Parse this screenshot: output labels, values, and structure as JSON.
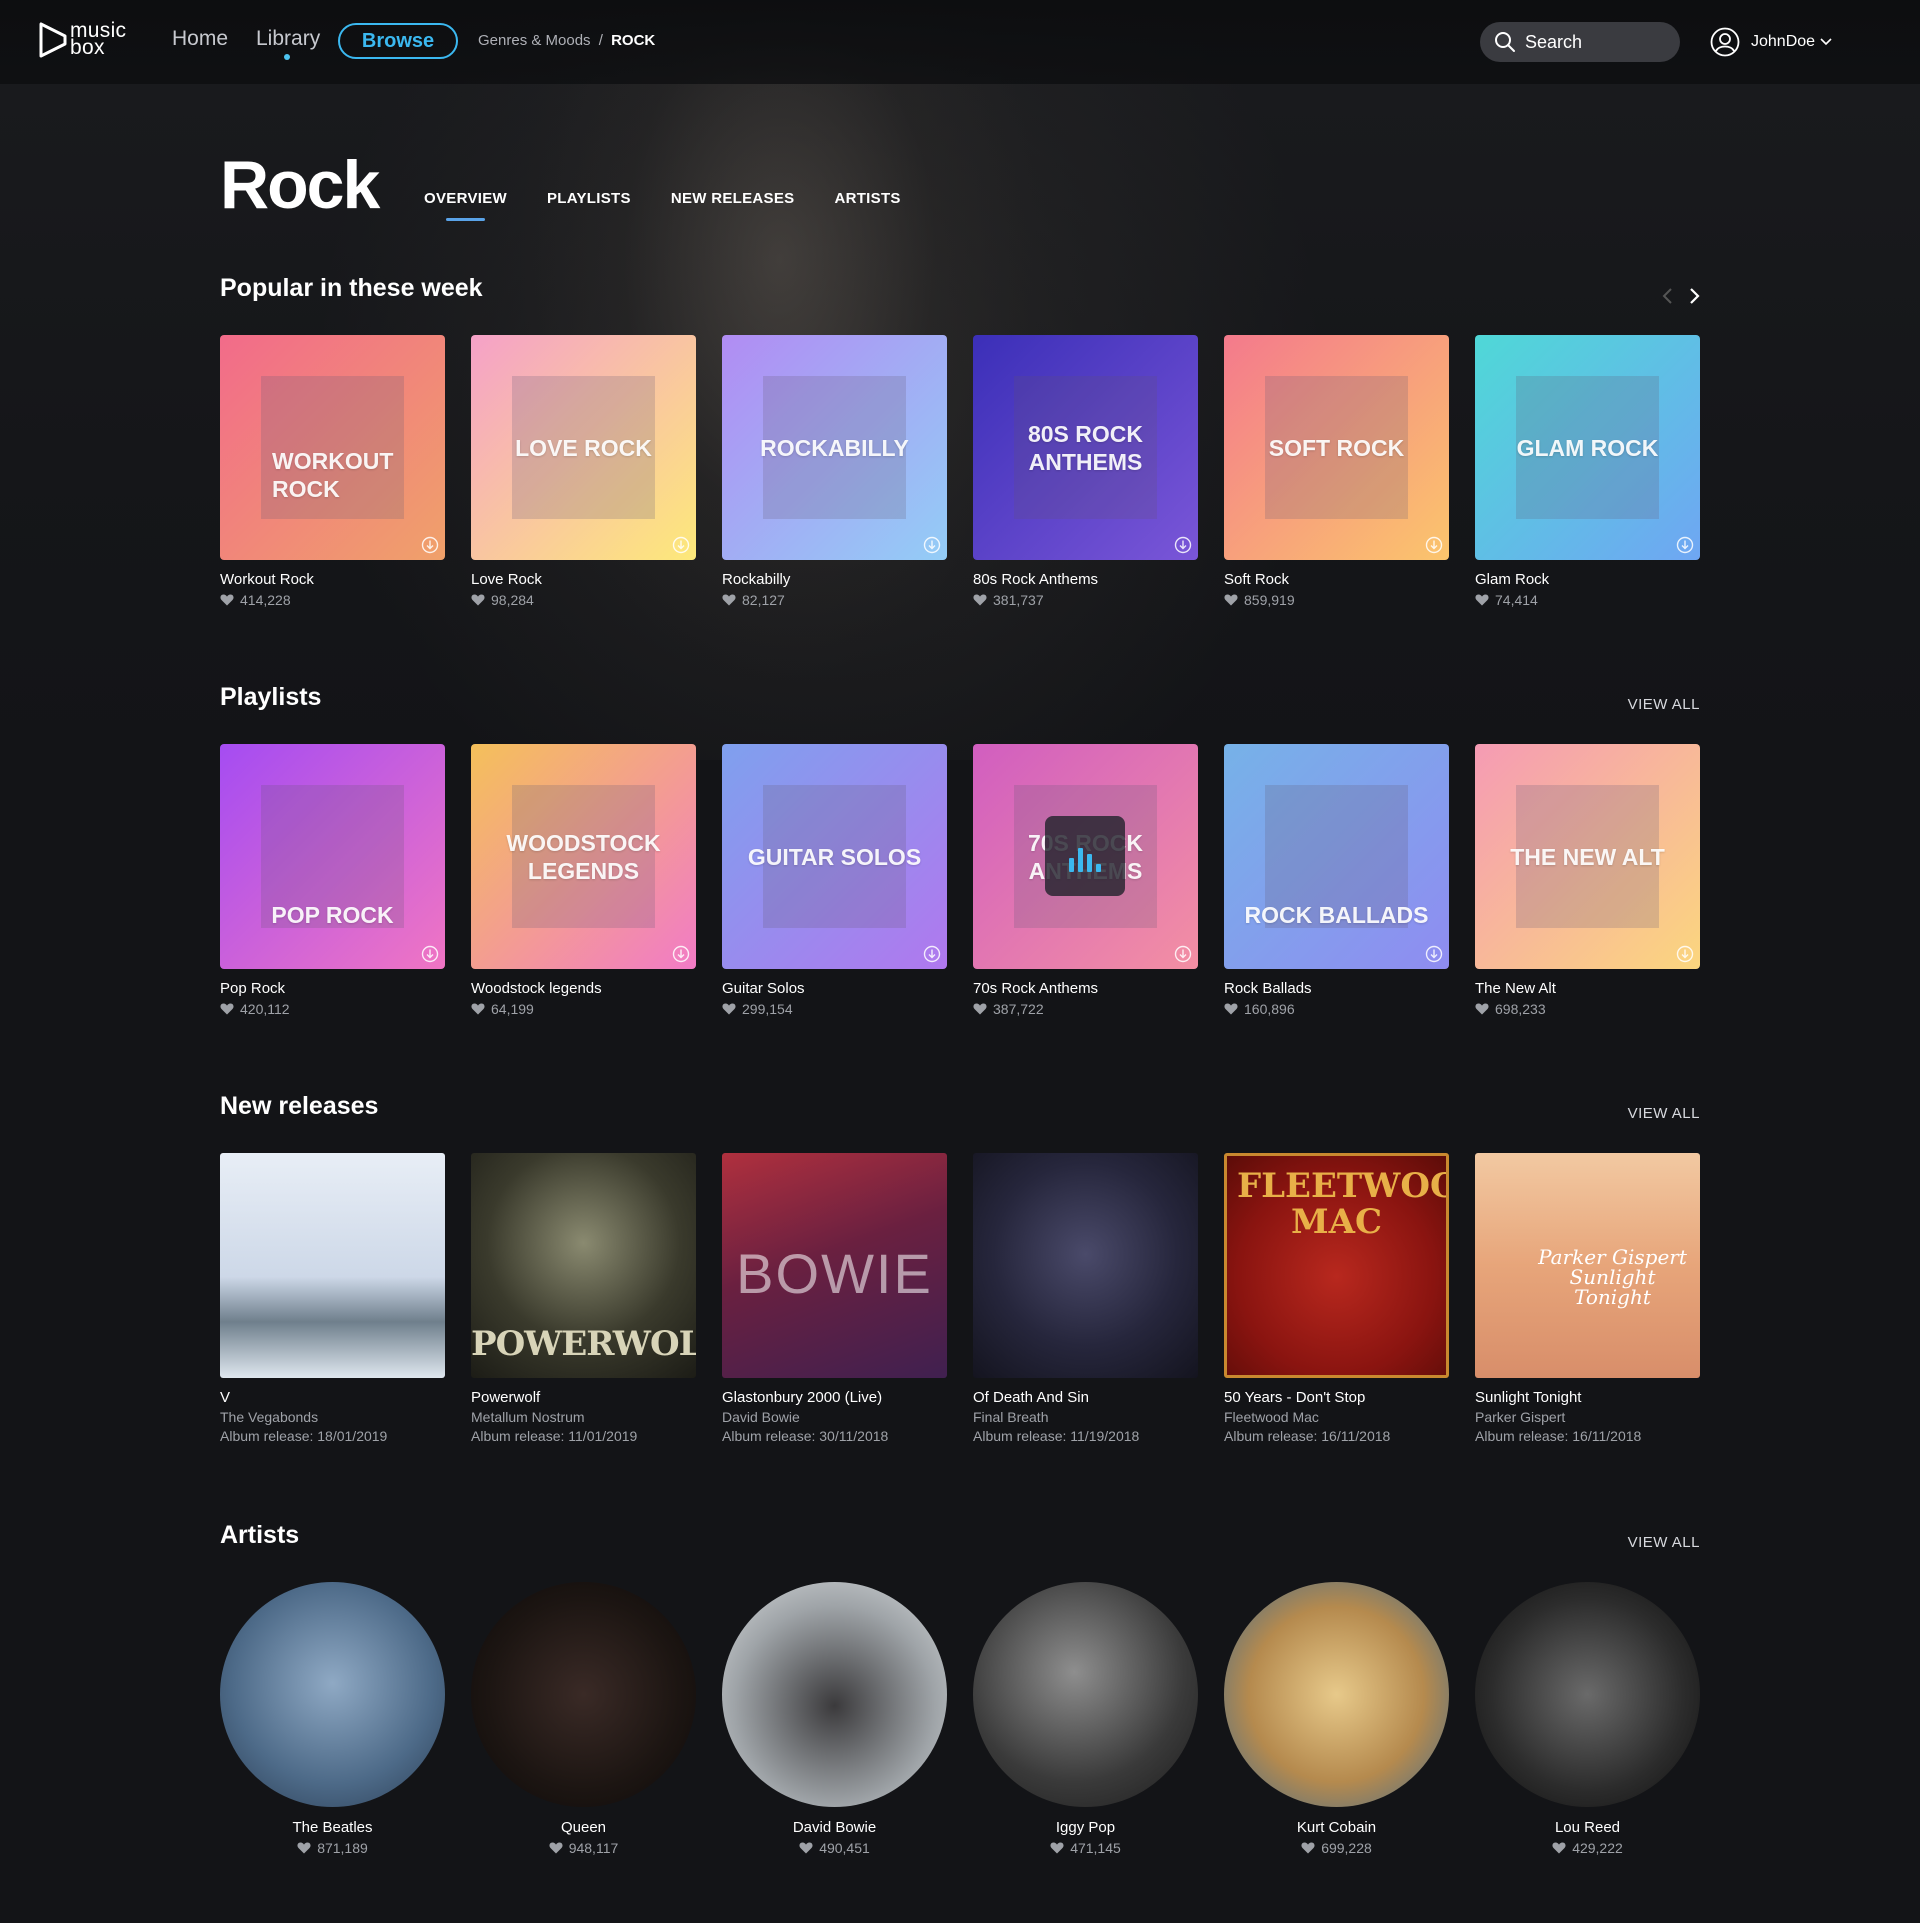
{
  "app": {
    "logo_text_line1": "music",
    "logo_text_line2": "box"
  },
  "nav": {
    "home": "Home",
    "library": "Library",
    "browse": "Browse",
    "breadcrumb": {
      "parent": "Genres & Moods",
      "sep": "/",
      "current": "ROCK"
    }
  },
  "search": {
    "label": "Search"
  },
  "user": {
    "name": "JohnDoe"
  },
  "page": {
    "title": "Rock",
    "tabs": [
      "OVERVIEW",
      "PLAYLISTS",
      "NEW RELEASES",
      "ARTISTS"
    ],
    "active_tab": "OVERVIEW"
  },
  "sections": {
    "popular": {
      "title": "Popular in these week",
      "items": [
        {
          "cover_text": "WORKOUT ROCK",
          "title": "Workout Rock",
          "likes": "414,228",
          "gradient": [
            "#f26b8a",
            "#f0a16a"
          ]
        },
        {
          "cover_text": "LOVE ROCK",
          "title": "Love Rock",
          "likes": "98,284",
          "gradient": [
            "#f5a1c8",
            "#fde97a"
          ]
        },
        {
          "cover_text": "ROCKABILLY",
          "title": "Rockabilly",
          "likes": "82,127",
          "gradient": [
            "#b18cf3",
            "#93cdf6"
          ]
        },
        {
          "cover_text": "80s ROCK ANTHEMS",
          "title": "80s Rock Anthems",
          "likes": "381,737",
          "gradient": [
            "#3b2fb8",
            "#7a56d8"
          ]
        },
        {
          "cover_text": "SOFT ROCK",
          "title": "Soft Rock",
          "likes": "859,919",
          "gradient": [
            "#f47a8c",
            "#fbc56c"
          ]
        },
        {
          "cover_text": "GLAM ROCK",
          "title": "Glam Rock",
          "likes": "74,414",
          "gradient": [
            "#4fd8d7",
            "#6fa6f3"
          ]
        }
      ]
    },
    "playlists": {
      "title": "Playlists",
      "view_all": "VIEW ALL",
      "items": [
        {
          "cover_text": "POP ROCK",
          "title": "Pop Rock",
          "likes": "420,112",
          "gradient": [
            "#a54cf2",
            "#f075c3"
          ]
        },
        {
          "cover_text": "WOODSTOCK LEGENDS",
          "title": "Woodstock legends",
          "likes": "64,199",
          "gradient": [
            "#f4c05a",
            "#f27bc6"
          ]
        },
        {
          "cover_text": "GUITAR SOLOS",
          "title": "Guitar Solos",
          "likes": "299,154",
          "gradient": [
            "#7fa0ee",
            "#b078ee"
          ]
        },
        {
          "cover_text": "70s ROCK ANTHEMS",
          "title": "70s Rock Anthems",
          "likes": "387,722",
          "gradient": [
            "#d15ec0",
            "#f38fa3"
          ]
        },
        {
          "cover_text": "ROCK BALLADS",
          "title": "Rock Ballads",
          "likes": "160,896",
          "gradient": [
            "#76b2e8",
            "#8f8cf1"
          ]
        },
        {
          "cover_text": "THE NEW ALT",
          "title": "The New Alt",
          "likes": "698,233",
          "gradient": [
            "#f59bb4",
            "#fbd67e"
          ]
        }
      ]
    },
    "new_releases": {
      "title": "New releases",
      "view_all": "VIEW ALL",
      "items": [
        {
          "title": "V",
          "artist": "The Vegabonds",
          "date": "Album release: 18/01/2019",
          "cover_text": ""
        },
        {
          "title": "Powerwolf",
          "artist": "Metallum Nostrum",
          "date": "Album release: 11/01/2019",
          "cover_text": "POWERWOLF"
        },
        {
          "title": "Glastonbury 2000 (Live)",
          "artist": "David Bowie",
          "date": "Album release: 30/11/2018",
          "cover_text": "BOWIE"
        },
        {
          "title": "Of Death And Sin",
          "artist": "Final Breath",
          "date": "Album release: 11/19/2018",
          "cover_text": ""
        },
        {
          "title": "50 Years - Don't Stop",
          "artist": "Fleetwood Mac",
          "date": "Album release: 16/11/2018",
          "cover_text": "FLEETWOOD MAC"
        },
        {
          "title": "Sunlight Tonight",
          "artist": "Parker Gispert",
          "date": "Album release: 16/11/2018",
          "cover_text": "Parker Gispert Sunlight Tonight"
        }
      ]
    },
    "artists": {
      "title": "Artists",
      "view_all": "VIEW ALL",
      "items": [
        {
          "name": "The Beatles",
          "likes": "871,189"
        },
        {
          "name": "Queen",
          "likes": "948,117"
        },
        {
          "name": "David Bowie",
          "likes": "490,451"
        },
        {
          "name": "Iggy Pop",
          "likes": "471,145"
        },
        {
          "name": "Kurt Cobain",
          "likes": "699,228"
        },
        {
          "name": "Lou Reed",
          "likes": "429,222"
        }
      ]
    }
  }
}
